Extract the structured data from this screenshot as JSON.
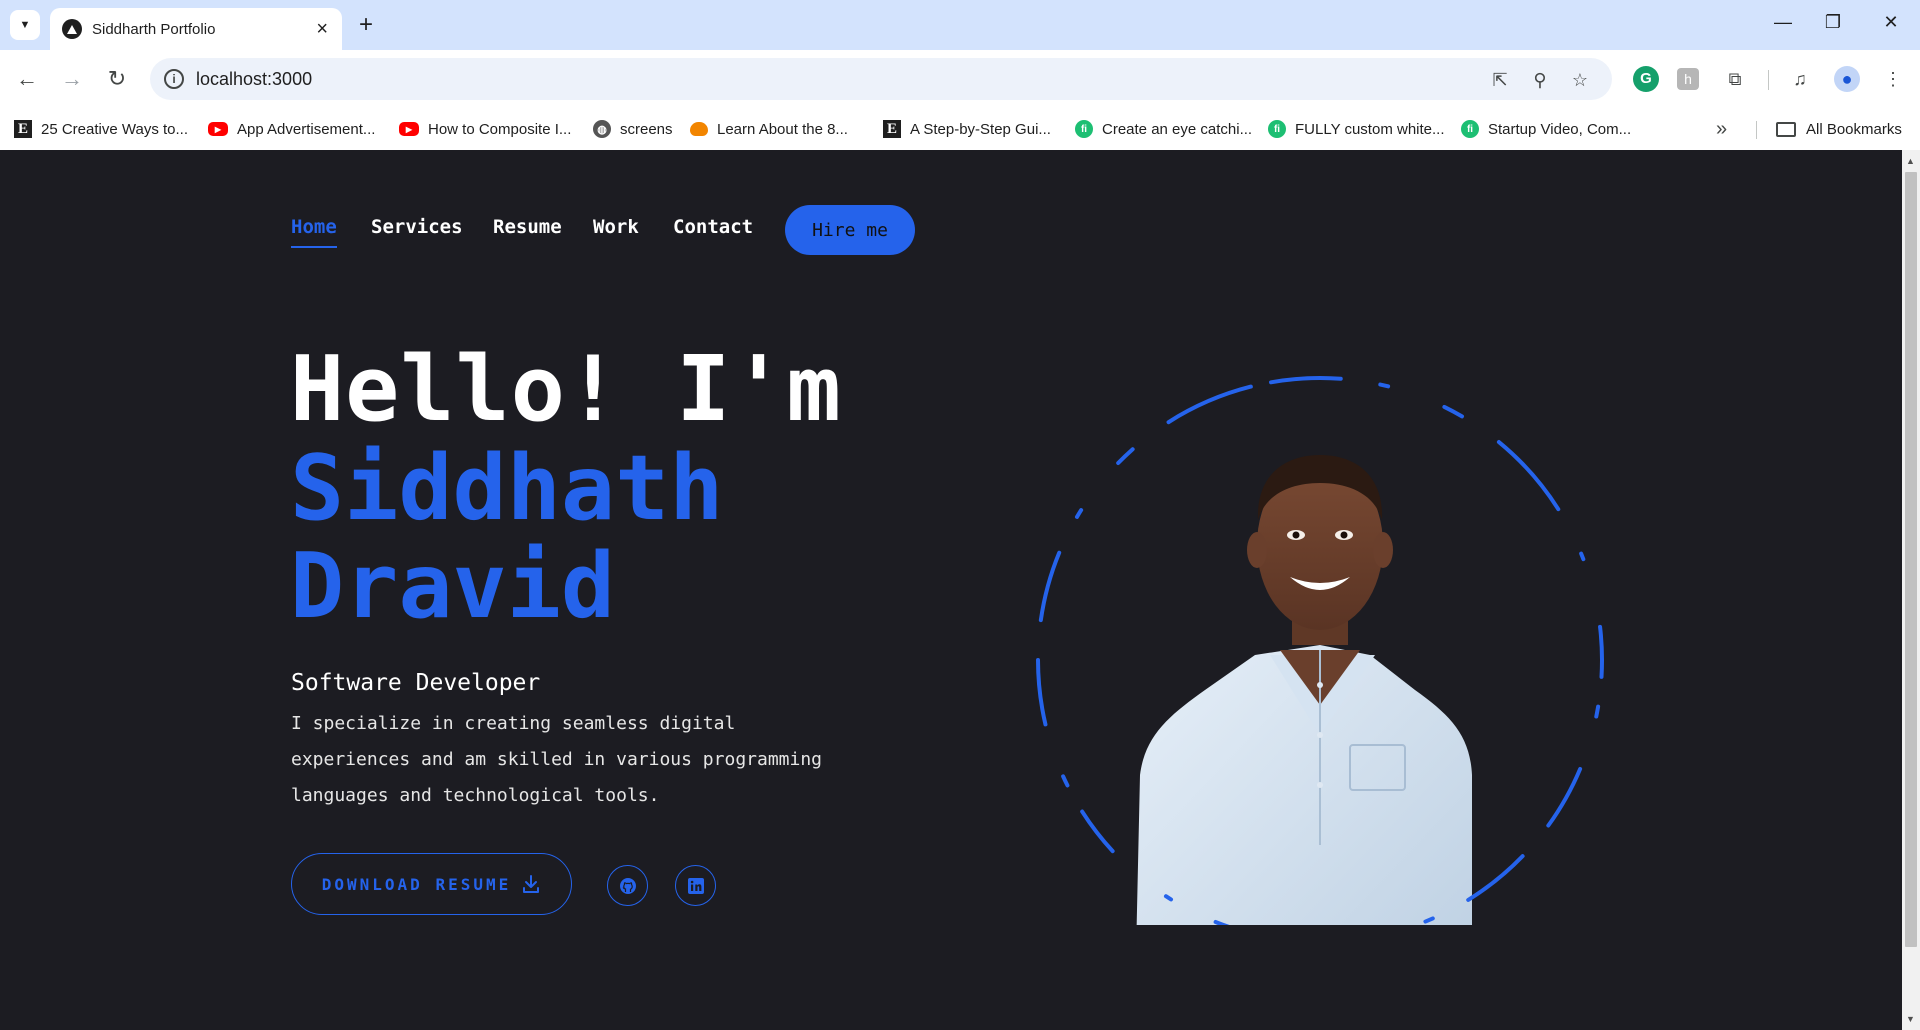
{
  "browser": {
    "tab_title": "Siddharth Portfolio",
    "url": "localhost:3000",
    "bookmarks": [
      {
        "label": "25 Creative Ways to...",
        "icon": "etsy-icon"
      },
      {
        "label": "App Advertisement...",
        "icon": "youtube-icon"
      },
      {
        "label": "How to Composite I...",
        "icon": "youtube-icon"
      },
      {
        "label": "screens",
        "icon": "globe-icon"
      },
      {
        "label": "Learn About the 8...",
        "icon": "cloud-icon"
      },
      {
        "label": "A Step-by-Step Gui...",
        "icon": "etsy-icon"
      },
      {
        "label": "Create an eye catchi...",
        "icon": "fiverr-icon"
      },
      {
        "label": "FULLY custom white...",
        "icon": "fiverr-icon"
      },
      {
        "label": "Startup Video, Com...",
        "icon": "fiverr-icon"
      }
    ],
    "all_bookmarks_label": "All Bookmarks"
  },
  "nav": {
    "items": [
      "Home",
      "Services",
      "Resume",
      "Work",
      "Contact"
    ],
    "active": "Home",
    "hire_label": "Hire me"
  },
  "hero": {
    "greeting": "Hello! I'm",
    "name_line1": "Siddhath",
    "name_line2": "Dravid",
    "role": "Software Developer",
    "description": "I specialize in creating seamless digital experiences and am skilled in various programming languages and technological tools.",
    "download_label": "DOWNLOAD RESUME"
  },
  "social": [
    "github-icon",
    "linkedin-icon"
  ],
  "colors": {
    "accent": "#2563eb",
    "background": "#1c1c22",
    "text": "#ffffff"
  }
}
